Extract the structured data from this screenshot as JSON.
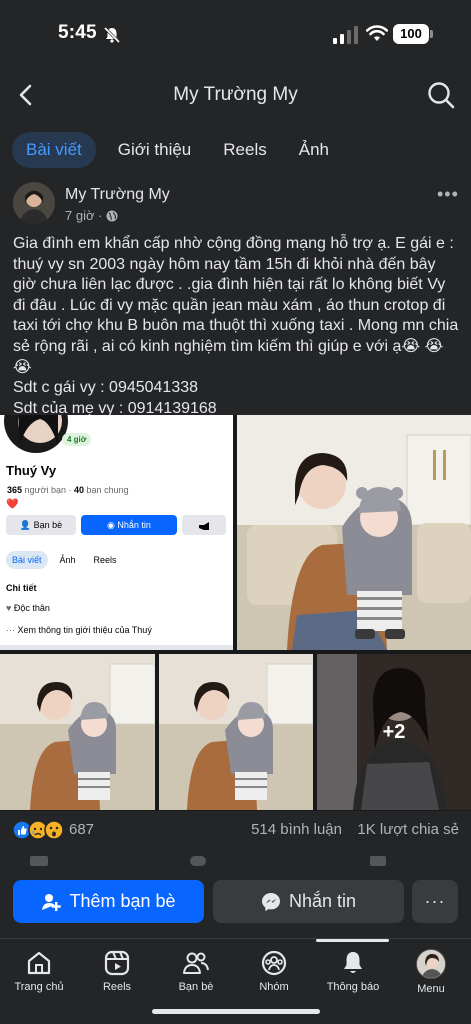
{
  "status_bar": {
    "time": "5:45",
    "battery": "100"
  },
  "header": {
    "title": "My Trường My"
  },
  "tabs": [
    {
      "label": "Bài viết"
    },
    {
      "label": "Giới thiệu"
    },
    {
      "label": "Reels"
    },
    {
      "label": "Ảnh"
    }
  ],
  "post": {
    "author": "My Trường My",
    "time": "7 giờ ·",
    "text_lines": [
      "Gia đình em khẩn cấp nhờ cộng đồng mạng hỗ trợ ạ. E gái e : thuý vy sn 2003 ngày hôm nay tầm 15h đi khỏi nhà đến bây giờ chưa liên lạc được . .gia đình hiện tại rất lo không biết Vy đi đâu . Lúc đi vy mặc quần jean màu xám , áo thun crotop đi taxi tới chợ khu B buôn ma thuột thì xuống taxi . Mong mn chia sẻ rộng rãi , ai có kinh nghiệm tìm kiếm thì giúp e với ạ😭 😭 😭",
      "Sdt c gái vy  : 0945041338",
      "Sdt của mẹ vy : 0914139168"
    ]
  },
  "embedded_profile": {
    "badge": "4 giờ",
    "name": "Thuý Vy",
    "friends_count": "365",
    "friends_label": "người bạn ·",
    "mutual_count": "40",
    "mutual_label": "bạn chung",
    "heart": "❤️",
    "btn_friends": "Bạn bè",
    "btn_message": "Nhắn tin",
    "tabs": [
      "Bài viết",
      "Ảnh",
      "Reels"
    ],
    "details_title": "Chi tiết",
    "detail_status": "Độc thân",
    "detail_more": "Xem thông tin giới thiệu của Thuý"
  },
  "photos": {
    "more_count": "+2"
  },
  "reactions": {
    "count": "687",
    "comments": "514 bình luận",
    "shares": "1K lượt chia sẻ"
  },
  "actions": {
    "add_friend": "Thêm bạn bè",
    "message": "Nhắn tin",
    "more": "···"
  },
  "bottom_nav": [
    {
      "label": "Trang chủ"
    },
    {
      "label": "Reels"
    },
    {
      "label": "Bạn bè"
    },
    {
      "label": "Nhóm"
    },
    {
      "label": "Thông báo"
    },
    {
      "label": "Menu"
    }
  ],
  "colors": {
    "background": "#242526",
    "accent": "#0866ff",
    "active_tab_bg": "#263951",
    "active_tab_text": "#4599ff",
    "secondary_text": "#b0b3b8"
  }
}
